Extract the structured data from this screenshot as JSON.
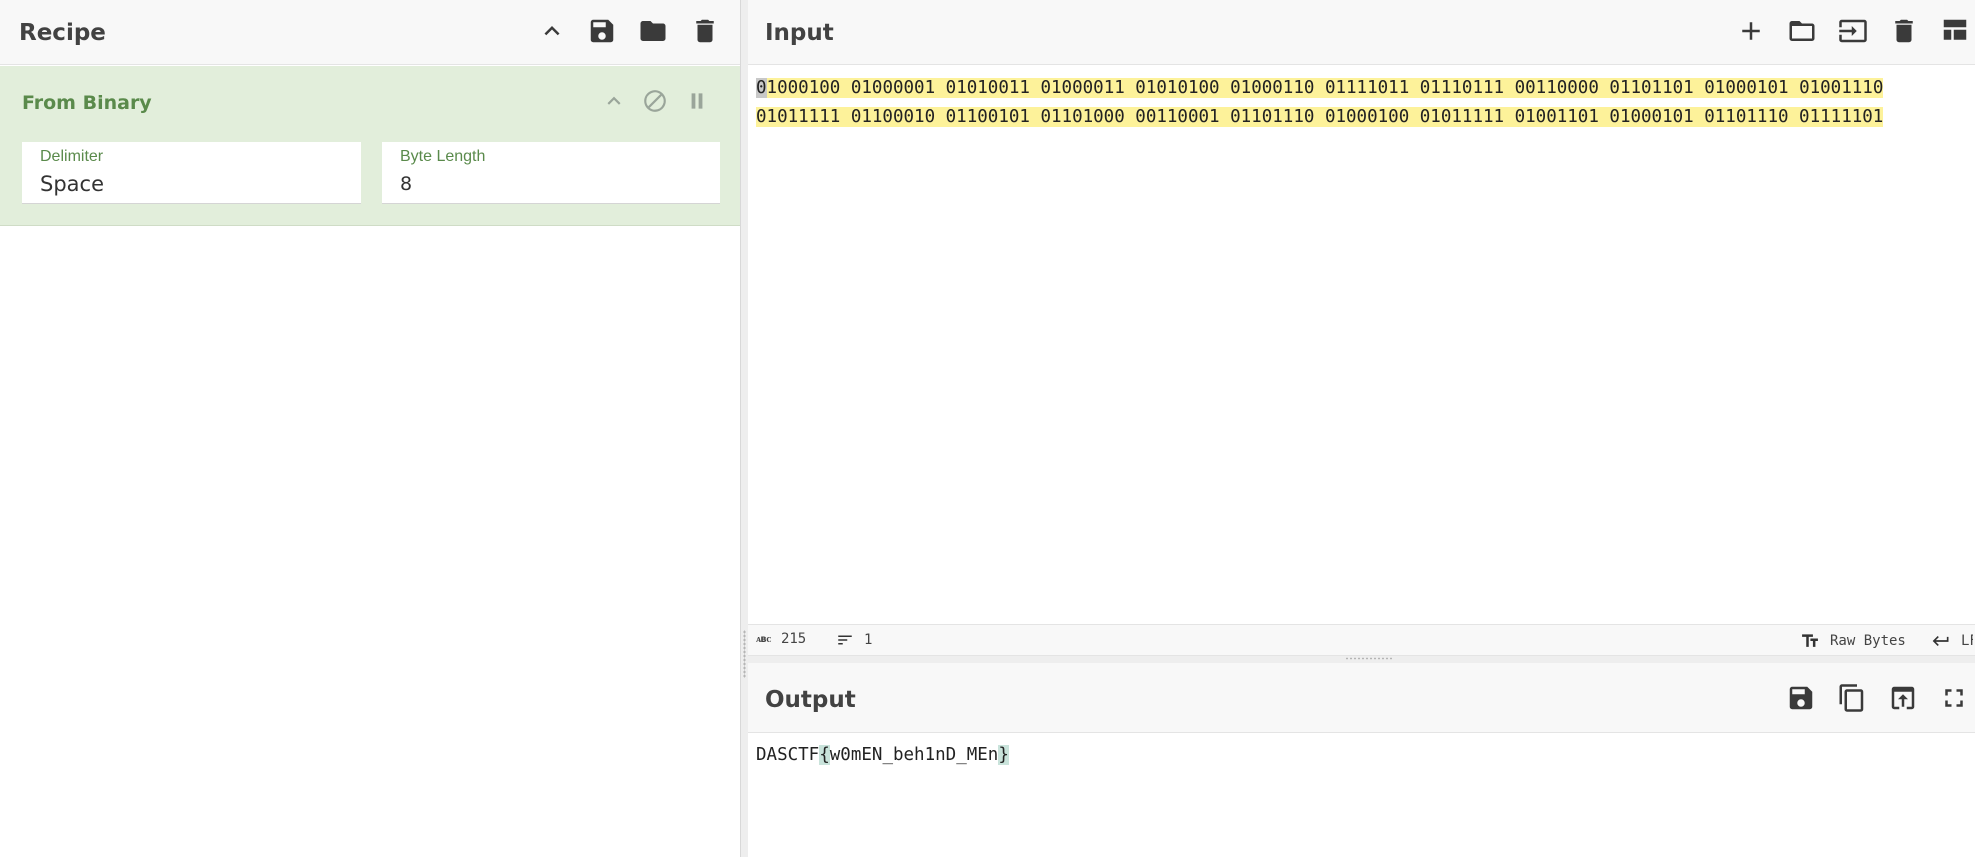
{
  "recipe": {
    "title": "Recipe",
    "icons": [
      "chevron-up-icon",
      "save-icon",
      "folder-icon",
      "trash-icon"
    ],
    "operation": {
      "name": "From Binary",
      "delimiter_label": "Delimiter",
      "delimiter_value": "Space",
      "byte_length_label": "Byte Length",
      "byte_length_value": "8"
    }
  },
  "input": {
    "title": "Input",
    "first_token": "0",
    "text_rest": "1000100 01000001 01010011 01000011 01010100 01000110 01111011 01110111 00110000 01101101 01000101 01001110 01011111 01100010 01100101 01101000 00110001 01101110 01000100 01011111 01001101 01000101 01101110 01111101",
    "status": {
      "char_count": "215",
      "line_count": "1",
      "encoding": "Raw Bytes",
      "eol": "LF"
    }
  },
  "output": {
    "title": "Output",
    "prefix": "DASCTF",
    "open_brace": "{",
    "inner": "w0mEN_beh1nD_MEn",
    "close_brace": "}"
  },
  "colors": {
    "operation_bg": "#e2eedb",
    "operation_title": "#5a8a4b",
    "input_highlight": "#fdf29a",
    "output_bracket_highlight": "#c9e3db"
  }
}
